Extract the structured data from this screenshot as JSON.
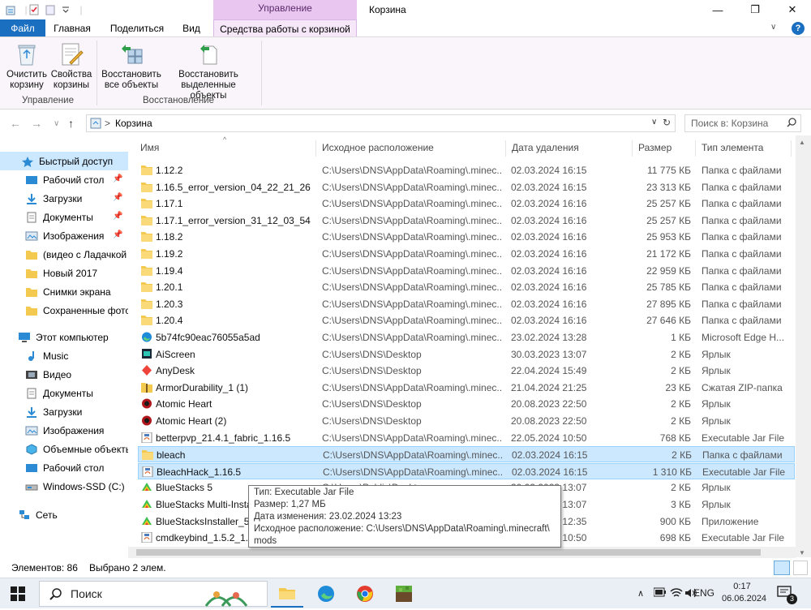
{
  "window": {
    "title": "Корзина",
    "context_header": "Управление",
    "minimize_glyph": "—",
    "maximize_glyph": "❐",
    "close_glyph": "✕"
  },
  "tabs": {
    "file": "Файл",
    "home": "Главная",
    "share": "Поделиться",
    "view": "Вид",
    "context": "Средства работы с корзиной"
  },
  "ribbon": {
    "empty_bin": [
      "Очистить",
      "корзину"
    ],
    "bin_props": [
      "Свойства",
      "корзины"
    ],
    "restore_all": [
      "Восстановить",
      "все объекты"
    ],
    "restore_selected": [
      "Восстановить",
      "выделенные объекты"
    ],
    "group_manage": "Управление",
    "group_restore": "Восстановление"
  },
  "address": {
    "path": "Корзина",
    "separator": ">",
    "search_placeholder": "Поиск в: Корзина"
  },
  "sidebar": {
    "quick_access": "Быстрый доступ",
    "items": [
      {
        "label": "Рабочий стол",
        "pinned": true
      },
      {
        "label": "Загрузки",
        "pinned": true
      },
      {
        "label": "Документы",
        "pinned": true
      },
      {
        "label": "Изображения",
        "pinned": true
      },
      {
        "label": "(видео с Ладачкой",
        "pinned": false
      },
      {
        "label": "Новый 2017",
        "pinned": false
      },
      {
        "label": "Снимки экрана",
        "pinned": false
      },
      {
        "label": "Сохраненные фото",
        "pinned": false
      }
    ],
    "this_pc": "Этот компьютер",
    "pc_items": [
      "Music",
      "Видео",
      "Документы",
      "Загрузки",
      "Изображения",
      "Объемные объекты",
      "Рабочий стол",
      "Windows-SSD (C:)"
    ],
    "network": "Сеть"
  },
  "columns": {
    "name": "Имя",
    "location": "Исходное расположение",
    "date": "Дата удаления",
    "size": "Размер",
    "type": "Тип элемента"
  },
  "files": [
    {
      "name": "1.12.2",
      "location": "C:\\Users\\DNS\\AppData\\Roaming\\.minec...",
      "date": "02.03.2024 16:15",
      "size": "11 775 КБ",
      "type": "Папка с файлами",
      "icon": "folder"
    },
    {
      "name": "1.16.5_error_version_04_22_21_26",
      "location": "C:\\Users\\DNS\\AppData\\Roaming\\.minec...",
      "date": "02.03.2024 16:15",
      "size": "23 313 КБ",
      "type": "Папка с файлами",
      "icon": "folder"
    },
    {
      "name": "1.17.1",
      "location": "C:\\Users\\DNS\\AppData\\Roaming\\.minec...",
      "date": "02.03.2024 16:16",
      "size": "25 257 КБ",
      "type": "Папка с файлами",
      "icon": "folder"
    },
    {
      "name": "1.17.1_error_version_31_12_03_54",
      "location": "C:\\Users\\DNS\\AppData\\Roaming\\.minec...",
      "date": "02.03.2024 16:16",
      "size": "25 257 КБ",
      "type": "Папка с файлами",
      "icon": "folder"
    },
    {
      "name": "1.18.2",
      "location": "C:\\Users\\DNS\\AppData\\Roaming\\.minec...",
      "date": "02.03.2024 16:16",
      "size": "25 953 КБ",
      "type": "Папка с файлами",
      "icon": "folder"
    },
    {
      "name": "1.19.2",
      "location": "C:\\Users\\DNS\\AppData\\Roaming\\.minec...",
      "date": "02.03.2024 16:16",
      "size": "21 172 КБ",
      "type": "Папка с файлами",
      "icon": "folder"
    },
    {
      "name": "1.19.4",
      "location": "C:\\Users\\DNS\\AppData\\Roaming\\.minec...",
      "date": "02.03.2024 16:16",
      "size": "22 959 КБ",
      "type": "Папка с файлами",
      "icon": "folder"
    },
    {
      "name": "1.20.1",
      "location": "C:\\Users\\DNS\\AppData\\Roaming\\.minec...",
      "date": "02.03.2024 16:16",
      "size": "25 785 КБ",
      "type": "Папка с файлами",
      "icon": "folder"
    },
    {
      "name": "1.20.3",
      "location": "C:\\Users\\DNS\\AppData\\Roaming\\.minec...",
      "date": "02.03.2024 16:16",
      "size": "27 895 КБ",
      "type": "Папка с файлами",
      "icon": "folder"
    },
    {
      "name": "1.20.4",
      "location": "C:\\Users\\DNS\\AppData\\Roaming\\.minec...",
      "date": "02.03.2024 16:16",
      "size": "27 646 КБ",
      "type": "Папка с файлами",
      "icon": "folder"
    },
    {
      "name": "5b74fc90eac76055a5ad",
      "location": "C:\\Users\\DNS\\AppData\\Roaming\\.minec...",
      "date": "23.02.2024 13:28",
      "size": "1 КБ",
      "type": "Microsoft Edge H...",
      "icon": "edge"
    },
    {
      "name": "AiScreen",
      "location": "C:\\Users\\DNS\\Desktop",
      "date": "30.03.2023 13:07",
      "size": "2 КБ",
      "type": "Ярлык",
      "icon": "dark"
    },
    {
      "name": "AnyDesk",
      "location": "C:\\Users\\DNS\\Desktop",
      "date": "22.04.2024 15:49",
      "size": "2 КБ",
      "type": "Ярлык",
      "icon": "red"
    },
    {
      "name": "ArmorDurability_1 (1)",
      "location": "C:\\Users\\DNS\\AppData\\Roaming\\.minec...",
      "date": "21.04.2024 21:25",
      "size": "23 КБ",
      "type": "Сжатая ZIP-папка",
      "icon": "zip"
    },
    {
      "name": "Atomic Heart",
      "location": "C:\\Users\\DNS\\Desktop",
      "date": "20.08.2023 22:50",
      "size": "2 КБ",
      "type": "Ярлык",
      "icon": "atomic"
    },
    {
      "name": "Atomic Heart (2)",
      "location": "C:\\Users\\DNS\\Desktop",
      "date": "20.08.2023 22:50",
      "size": "2 КБ",
      "type": "Ярлык",
      "icon": "atomic"
    },
    {
      "name": "betterpvp_21.4.1_fabric_1.16.5",
      "location": "C:\\Users\\DNS\\AppData\\Roaming\\.minec...",
      "date": "22.05.2024 10:50",
      "size": "768 КБ",
      "type": "Executable Jar File",
      "icon": "jar"
    },
    {
      "name": "bleach",
      "location": "C:\\Users\\DNS\\AppData\\Roaming\\.minec...",
      "date": "02.03.2024 16:15",
      "size": "2 КБ",
      "type": "Папка с файлами",
      "icon": "folder",
      "selected": true
    },
    {
      "name": "BleachHack_1.16.5",
      "location": "C:\\Users\\DNS\\AppData\\Roaming\\.minec...",
      "date": "02.03.2024 16:15",
      "size": "1 310 КБ",
      "type": "Executable Jar File",
      "icon": "jar",
      "selected": true
    },
    {
      "name": "BlueStacks 5",
      "location": "C:\\Users\\Public\\Desktop",
      "date": "30.03.2023 13:07",
      "size": "2 КБ",
      "type": "Ярлык",
      "icon": "bluestacks"
    },
    {
      "name": "BlueStacks Multi-Instance Manager",
      "location": "C:\\Users\\Public\\Desktop",
      "date": "30.03.2023 13:07",
      "size": "3 КБ",
      "type": "Ярлык",
      "icon": "bluestacks"
    },
    {
      "name": "BlueStacksInstaller_5.11",
      "location": "C:\\Users\\DNS\\Downloads",
      "date": "30.03.2023 12:35",
      "size": "900 КБ",
      "type": "Приложение",
      "icon": "bluestacks"
    },
    {
      "name": "cmdkeybind_1.5.2_1.16.5",
      "location": "C:\\Users\\DNS\\AppData\\Roaming\\.minec...",
      "date": "22.05.2024 10:50",
      "size": "698 КБ",
      "type": "Executable Jar File",
      "icon": "jar"
    }
  ],
  "tooltip": {
    "line1": "Тип: Executable Jar File",
    "line2": "Размер: 1,27 МБ",
    "line3": "Дата изменения: 23.02.2024 13:23",
    "line4": "Исходное расположение: C:\\Users\\DNS\\AppData\\Roaming\\.minecraft\\",
    "line5": "mods"
  },
  "status": {
    "count": "Элементов: 86",
    "selected": "Выбрано 2 элем."
  },
  "taskbar": {
    "search": "Поиск",
    "lang": "ENG",
    "time": "0:17",
    "date": "06.06.2024",
    "notif_count": "3"
  },
  "colors": {
    "accent": "#1a6fc1",
    "context_tab": "#e8c6f0",
    "selection": "#cce8ff",
    "folder": "#f4c94f"
  }
}
